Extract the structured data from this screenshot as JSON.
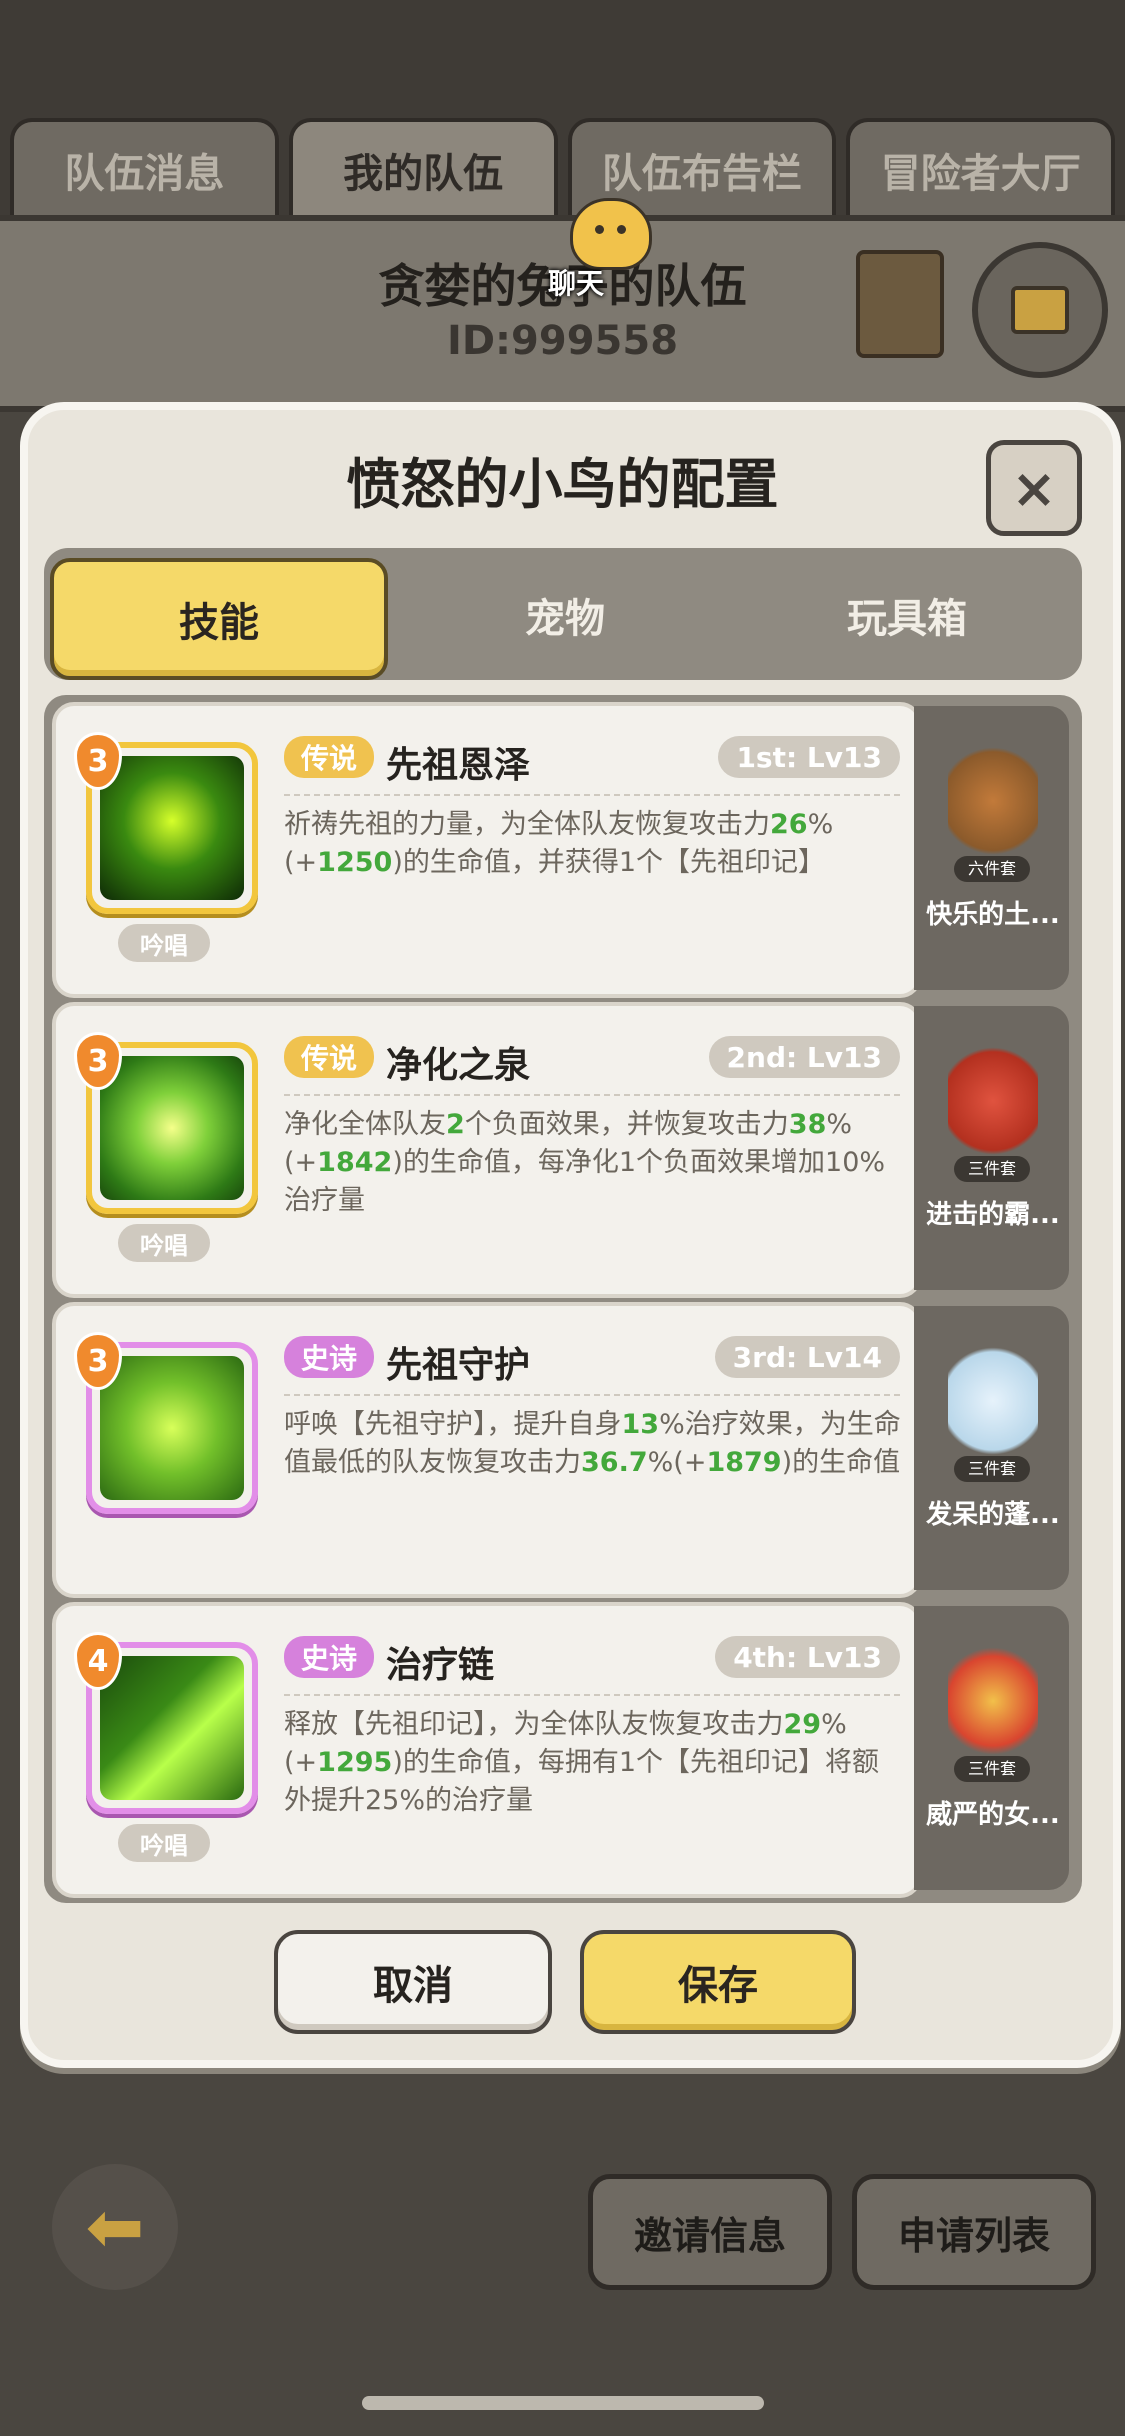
{
  "top_tabs": [
    {
      "label": "队伍消息",
      "active": false
    },
    {
      "label": "我的队伍",
      "active": true
    },
    {
      "label": "队伍布告栏",
      "active": false
    },
    {
      "label": "冒险者大厅",
      "active": false
    }
  ],
  "team": {
    "name": "贪婪的兔子的队伍",
    "id_text": "ID:999558",
    "chat_label": "聊天"
  },
  "modal": {
    "title": "愤怒的小鸟的配置",
    "close_label": "×",
    "segments": [
      {
        "label": "技能",
        "active": true
      },
      {
        "label": "宠物",
        "active": false
      },
      {
        "label": "玩具箱",
        "active": false
      }
    ],
    "skills": [
      {
        "rarity": "传说",
        "name": "先祖恩泽",
        "slot": "1st: Lv13",
        "level_badge": "3",
        "chant": "吟唱",
        "desc": [
          {
            "t": "祈祷先祖的力量，为全体队友恢复攻击力"
          },
          {
            "t": "26",
            "hl": true
          },
          {
            "t": "%(+"
          },
          {
            "t": "1250",
            "hl": true
          },
          {
            "t": ")的生命值，并获得1个【先祖印记】"
          }
        ],
        "side_name": "快乐的土...",
        "side_badge": "六件套"
      },
      {
        "rarity": "传说",
        "name": "净化之泉",
        "slot": "2nd: Lv13",
        "level_badge": "3",
        "chant": "吟唱",
        "desc": [
          {
            "t": "净化全体队友"
          },
          {
            "t": "2",
            "hl": true
          },
          {
            "t": "个负面效果，并恢复攻击力"
          },
          {
            "t": "38",
            "hl": true
          },
          {
            "t": "%(+"
          },
          {
            "t": "1842",
            "hl": true
          },
          {
            "t": ")的生命值，每净化1个负面效果增加10%治疗量"
          }
        ],
        "side_name": "进击的霸...",
        "side_badge": "三件套"
      },
      {
        "rarity": "史诗",
        "name": "先祖守护",
        "slot": "3rd: Lv14",
        "level_badge": "3",
        "chant": "",
        "desc": [
          {
            "t": "呼唤【先祖守护】，提升自身"
          },
          {
            "t": "13",
            "hl": true
          },
          {
            "t": "%治疗效果，为生命值最低的队友恢复攻击力"
          },
          {
            "t": "36.7",
            "hl": true
          },
          {
            "t": "%(+"
          },
          {
            "t": "1879",
            "hl": true
          },
          {
            "t": ")的生命值"
          }
        ],
        "side_name": "发呆的蓬...",
        "side_badge": "三件套"
      },
      {
        "rarity": "史诗",
        "name": "治疗链",
        "slot": "4th: Lv13",
        "level_badge": "4",
        "chant": "吟唱",
        "desc": [
          {
            "t": "释放【先祖印记】，为全体队友恢复攻击力"
          },
          {
            "t": "29",
            "hl": true
          },
          {
            "t": "%(+"
          },
          {
            "t": "1295",
            "hl": true
          },
          {
            "t": ")的生命值，每拥有1个【先祖印记】将额外提升25%的治疗量"
          }
        ],
        "side_name": "威严的女...",
        "side_badge": "三件套"
      }
    ],
    "cancel_label": "取消",
    "save_label": "保存"
  },
  "bottom": {
    "invite_label": "邀请信息",
    "apply_label": "申请列表"
  },
  "colors": {
    "legend": "#f0c24f",
    "epic": "#d681dc",
    "highlight": "#43a83b",
    "accent_yellow": "#f5d969"
  }
}
